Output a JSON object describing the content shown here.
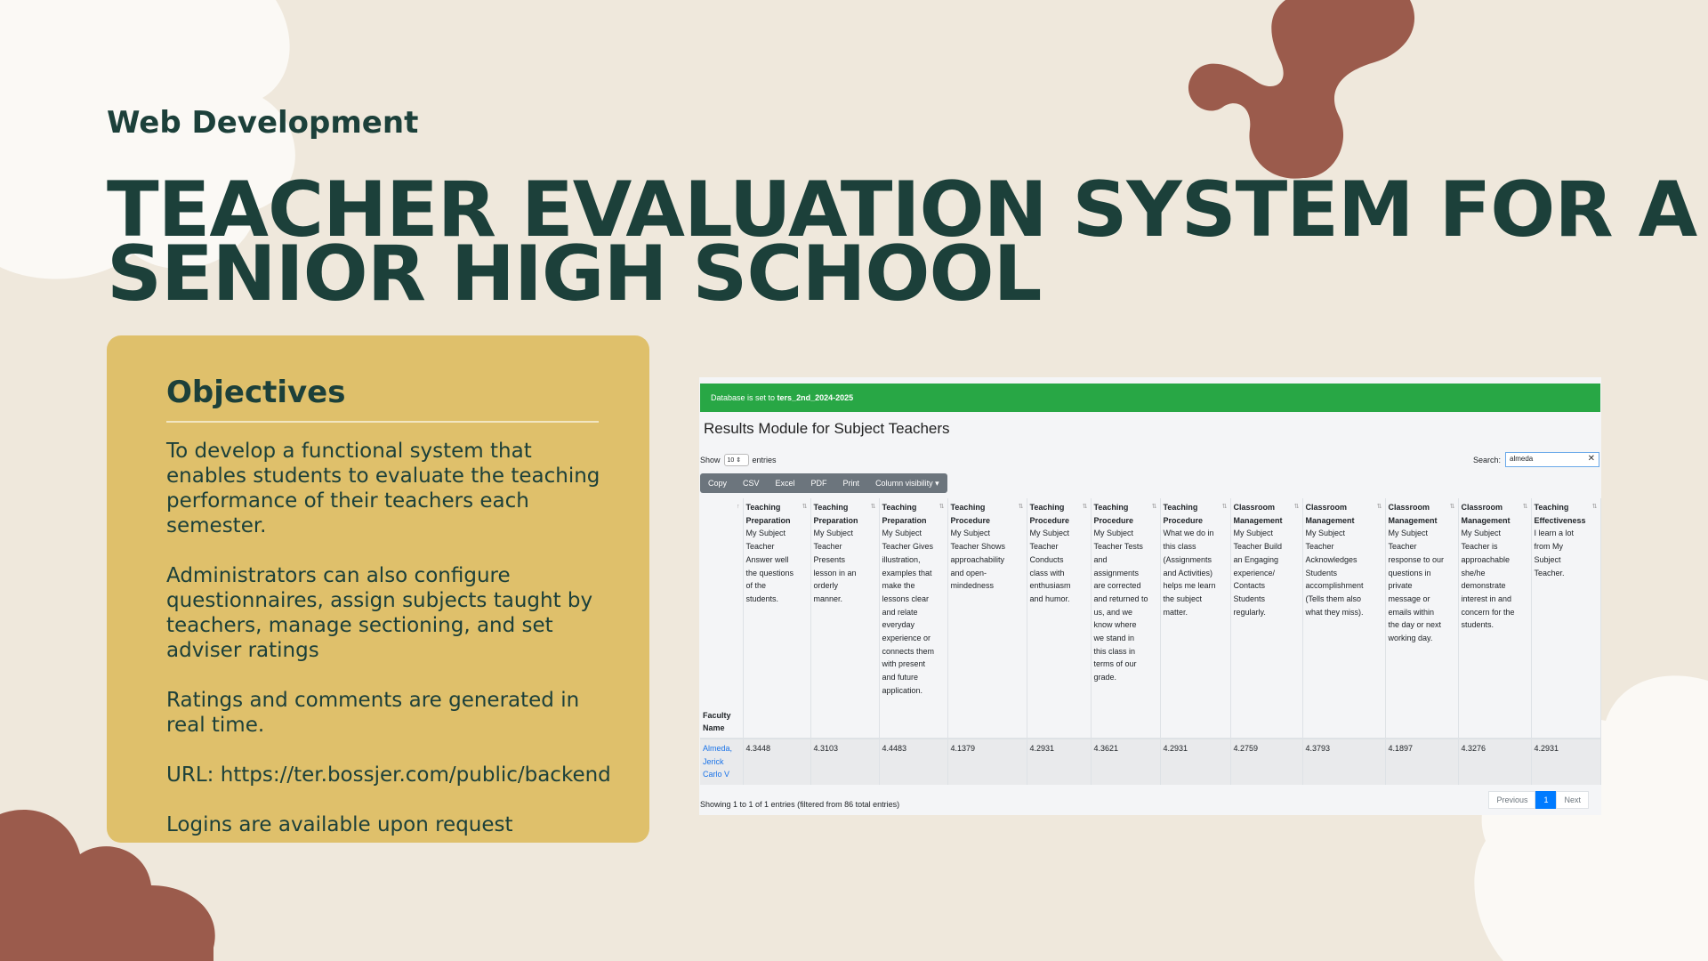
{
  "subtitle": "Web Development",
  "title_line1": "TEACHER EVALUATION SYSTEM FOR A",
  "title_line2": "SENIOR HIGH SCHOOL",
  "colors": {
    "background": "#efe8dc",
    "card": "#dfc06b",
    "brown_shape": "#9b5b4c",
    "heading": "#1c403a"
  },
  "objectives": {
    "heading": "Objectives",
    "items": [
      "To develop a functional system that enables students to evaluate the teaching performance of their teachers each semester.",
      "Administrators can also configure questionnaires, assign subjects taught by teachers, manage sectioning, and set adviser ratings",
      "Ratings and comments are generated in real time.",
      "URL: https://ter.bossjer.com/public/backend",
      "Logins are available upon request"
    ]
  },
  "app": {
    "alert_prefix": "Database is set to ",
    "alert_db": "ters_2nd_2024-2025",
    "module_title": "Results Module for Subject Teachers",
    "show_label": "Show",
    "show_value": "10",
    "entries_label": "entries",
    "search_label": "Search:",
    "search_value": "almeda",
    "buttons": [
      "Copy",
      "CSV",
      "Excel",
      "PDF",
      "Print",
      "Column visibility ▾"
    ],
    "faculty_header": "Faculty Name",
    "columns": [
      {
        "cat": "Teaching Preparation",
        "q": "My Subject Teacher Answer well the questions of the students."
      },
      {
        "cat": "Teaching Preparation",
        "q": "My Subject Teacher Presents lesson in an orderly manner."
      },
      {
        "cat": "Teaching Preparation",
        "q": "My Subject Teacher Gives illustration, examples that make the lessons clear and relate everyday experience or connects them with present and future application."
      },
      {
        "cat": "Teaching Procedure",
        "q": "My Subject Teacher Shows approachability and open-mindedness"
      },
      {
        "cat": "Teaching Procedure",
        "q": "My Subject Teacher Conducts class with enthusiasm and humor."
      },
      {
        "cat": "Teaching Procedure",
        "q": "My Subject Teacher Tests and assignments are corrected and returned to us, and we know where we stand in this class in terms of our grade."
      },
      {
        "cat": "Teaching Procedure",
        "q": "What we do in this class (Assignments and Activities) helps me learn the subject matter."
      },
      {
        "cat": "Classroom Management",
        "q": "My Subject Teacher Build an Engaging experience/ Contacts Students regularly."
      },
      {
        "cat": "Classroom Management",
        "q": "My Subject Teacher Acknowledges Students accomplishment (Tells them also what they miss)."
      },
      {
        "cat": "Classroom Management",
        "q": "My Subject Teacher response to our questions in private message or emails within the day or next working day."
      },
      {
        "cat": "Classroom Management",
        "q": "My Subject Teacher is approachable she/he demonstrate interest in and concern for the students."
      },
      {
        "cat": "Teaching Effectiveness",
        "q": "I learn a lot from My Subject Teacher."
      }
    ],
    "row": {
      "faculty": "Almeda, Jerick Carlo V",
      "scores": [
        "4.3448",
        "4.3103",
        "4.4483",
        "4.1379",
        "4.2931",
        "4.3621",
        "4.2931",
        "4.2759",
        "4.3793",
        "4.1897",
        "4.3276",
        "4.2931"
      ]
    },
    "footer_info": "Showing 1 to 1 of 1 entries (filtered from 86 total entries)",
    "pager": {
      "prev": "Previous",
      "page": "1",
      "next": "Next"
    }
  }
}
